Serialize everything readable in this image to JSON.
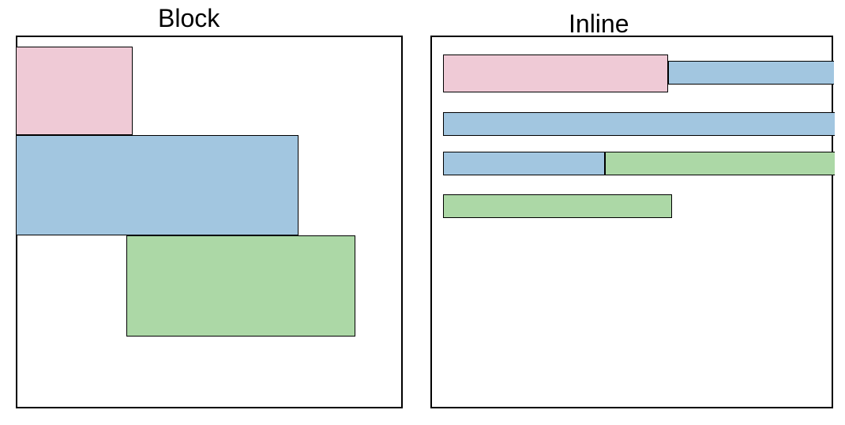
{
  "diagram": {
    "left": {
      "title": "Block",
      "boxes": [
        {
          "name": "pink",
          "color": "#efcad6"
        },
        {
          "name": "blue",
          "color": "#a2c6e0"
        },
        {
          "name": "green",
          "color": "#acd8a6"
        }
      ]
    },
    "right": {
      "title": "Inline",
      "boxes": [
        {
          "name": "pink",
          "color": "#efcad6"
        },
        {
          "name": "blue-segment-1",
          "color": "#a2c6e0"
        },
        {
          "name": "blue-segment-2",
          "color": "#a2c6e0"
        },
        {
          "name": "blue-segment-3",
          "color": "#a2c6e0"
        },
        {
          "name": "green-segment-1",
          "color": "#acd8a6"
        },
        {
          "name": "green-segment-2",
          "color": "#acd8a6"
        }
      ]
    }
  },
  "colors": {
    "pink": "#efcad6",
    "blue": "#a2c6e0",
    "green": "#acd8a6",
    "border": "#000000",
    "background": "#ffffff"
  }
}
